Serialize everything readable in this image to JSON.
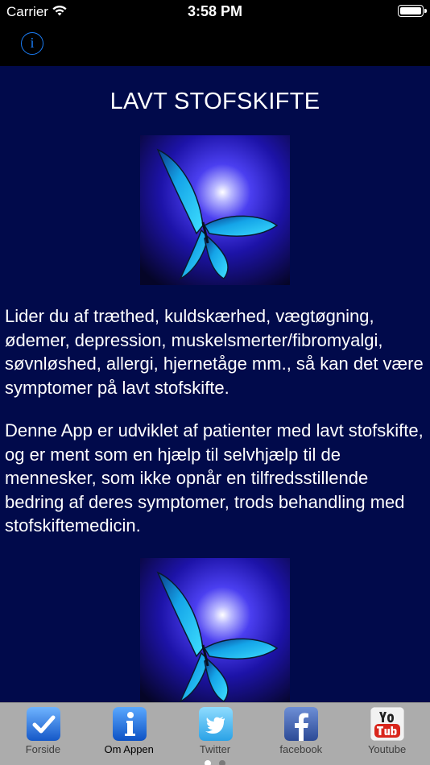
{
  "status_bar": {
    "carrier": "Carrier",
    "time": "3:58 PM",
    "battery_percent": 100
  },
  "nav_bar": {
    "info_glyph": "i"
  },
  "content": {
    "title": "LAVT STOFSKIFTE",
    "paragraph_1": "Lider du af træthed, kuldskærhed, vægtøgning, ødemer, depression, muskelsmerter/fibromyalgi, søvnløshed, allergi, hjernetåge mm., så kan det være symptomer på lavt stofskifte.",
    "paragraph_2": "Denne App er udviklet af patienter med lavt stofskifte, og er ment som en hjælp til selvhjælp til de mennesker, som ikke opnår en tilfredsstillende bedring af deres symptomer, trods behandling med stofskiftemedicin."
  },
  "tab_bar": {
    "tabs": [
      {
        "label": "Forside",
        "icon": "checkmark-icon",
        "active": false
      },
      {
        "label": "Om Appen",
        "icon": "info-icon",
        "active": true
      },
      {
        "label": "Twitter",
        "icon": "twitter-bird-icon",
        "active": false
      },
      {
        "label": "facebook",
        "icon": "facebook-icon",
        "active": false
      },
      {
        "label": "Youtube",
        "icon": "youtube-icon",
        "active": false
      }
    ],
    "page_count": 2,
    "current_page": 1
  },
  "colors": {
    "background": "#010a4b",
    "accent": "#1a7cf5",
    "tab_bar": "#acacac",
    "text": "#ffffff"
  }
}
